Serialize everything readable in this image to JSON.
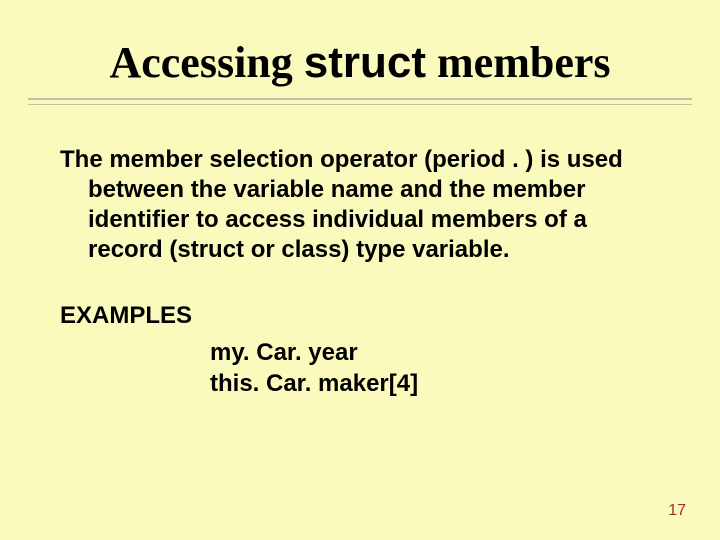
{
  "title": {
    "pre": "Accessing ",
    "struct_word": "struct",
    "post": " members"
  },
  "paragraph": "The member selection operator (period . ) is used between the variable name and the member identifier to access individual members of a record (struct or class) type variable.",
  "examples_label": "EXAMPLES",
  "examples": {
    "e0": "my. Car. year",
    "e1": "this. Car. maker[4]"
  },
  "page_number": "17"
}
